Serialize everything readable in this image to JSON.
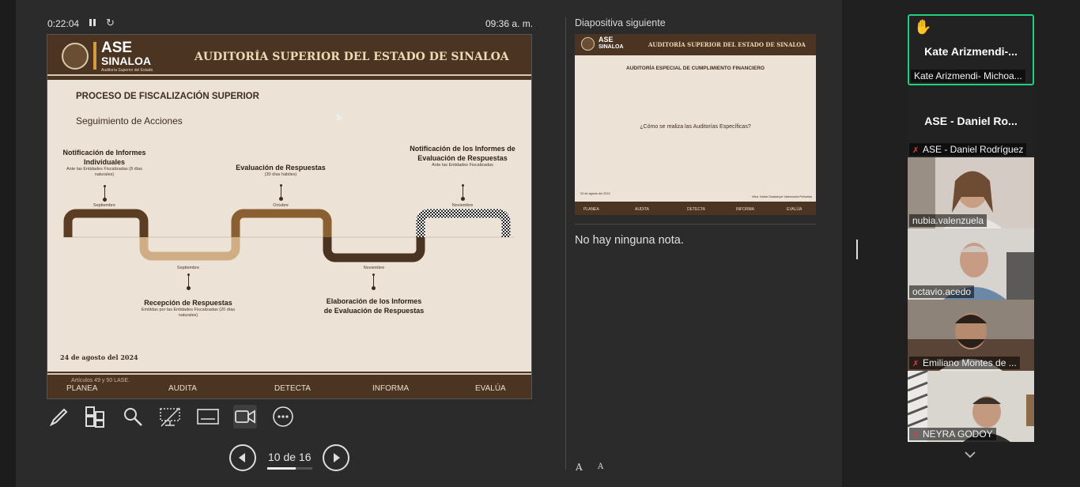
{
  "presenter": {
    "elapsed": "0:22:04",
    "clock": "09:36 a. m.",
    "current_slide": {
      "logo_main": "ASE",
      "logo_sub": "SINALOA",
      "logo_tiny": "Auditoría Superior del Estado",
      "title": "AUDITORÍA SUPERIOR DEL ESTADO DE SINALOA",
      "process_title": "PROCESO DE FISCALIZACIÓN SUPERIOR",
      "process_sub": "Seguimiento de Acciones",
      "steps": [
        {
          "head": "Notificación de Informes Individuales",
          "note": "Ante las Entidades Fiscalizadas (8 días naturales)",
          "month": "Septiembre"
        },
        {
          "head": "Recepción de Respuestas",
          "note": "Emitidas por las Entidades Fiscalizadas (20 días naturales)",
          "month": "Septiembre"
        },
        {
          "head": "Evaluación de Respuestas",
          "note": "(30 días hábiles)",
          "month": "Octubre"
        },
        {
          "head": "Elaboración de los Informes de Evaluación de Respuestas",
          "note": "",
          "month": "Noviembre"
        },
        {
          "head": "Notificación de los Informes de Evaluación de Respuestas",
          "note": "Ante las Entidades Fiscalizadas",
          "month": "Noviembre"
        }
      ],
      "date": "24 de agosto del 2024",
      "footer_note": "Artículos 49 y 50 LASE.",
      "footer_items": [
        "PLANEA",
        "AUDITA",
        "DETECTA",
        "INFORMA",
        "EVALÚA"
      ]
    },
    "toolbar": {
      "pen": "pen-icon",
      "slides": "all-slides-icon",
      "zoom": "magnifier-icon",
      "blackout": "screen-off-icon",
      "subtitles": "subtitles-icon",
      "camera": "camera-icon",
      "more": "more-options-icon"
    },
    "page_indicator": "10 de 16",
    "page_progress": 0.625,
    "next_slide_label": "Diapositiva siguiente",
    "next_slide": {
      "logo_main": "ASE",
      "logo_sub": "SINALOA",
      "title": "AUDITORÍA SUPERIOR DEL ESTADO DE SINALOA",
      "subtitle": "AUDITORÍA ESPECIAL DE CUMPLIMIENTO FINANCIERO",
      "question": "¿Cómo se realiza las Auditorías Específicas?",
      "date": "24 de agosto del 2024",
      "signature": "Mtra. Nubia Guadalupe Valenzuela Peñuelas",
      "footer_items": [
        "PLANEA",
        "AUDITA",
        "DETECTA",
        "INFORMA",
        "EVALÚA"
      ]
    },
    "notes": "No hay ninguna nota.",
    "font_increase": "A",
    "font_decrease": "A"
  },
  "participants": [
    {
      "big_name": "Kate Arizmendi-...",
      "label": "Kate Arizmendi- Michoa...",
      "hand_raised": true,
      "video": false,
      "muted": false
    },
    {
      "big_name": "ASE - Daniel Ro...",
      "label": "ASE - Daniel Rodríguez",
      "hand_raised": false,
      "video": false,
      "muted": true
    },
    {
      "label": "nubia.valenzuela",
      "video": true,
      "muted": false
    },
    {
      "label": "octavio.acedo",
      "video": true,
      "muted": false
    },
    {
      "label": "Emiliano Montes de ...",
      "video": true,
      "muted": true
    },
    {
      "label": "NEYRA GODOY",
      "video": true,
      "muted": true
    }
  ],
  "colors": {
    "slide_brown": "#4b3522",
    "slide_bg": "#ede2d6",
    "active_border": "#1fce7e"
  }
}
